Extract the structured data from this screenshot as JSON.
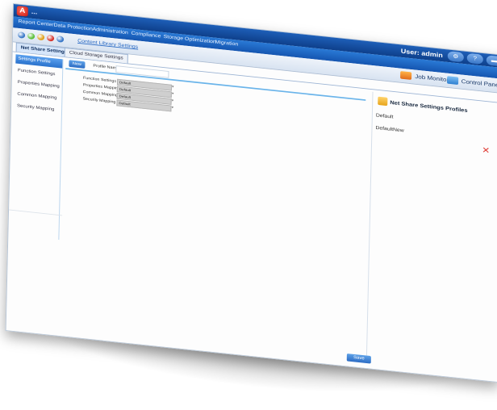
{
  "window": {
    "logo_letter": "A",
    "logo_text": "..."
  },
  "nav": {
    "items": [
      "Report Center",
      "Data Protection",
      "Administration",
      "Compliance",
      "Storage Optimization",
      "Migration"
    ]
  },
  "header": {
    "user": "User: admin",
    "icons": [
      "gear-icon",
      "help-icon",
      "minimize-icon"
    ]
  },
  "toolbar": {
    "breadcrumb": "Content Library Settings",
    "job_monitor": "Job Monitor",
    "control_panel": "Control Panel",
    "status_dots": [
      "#3a78c8",
      "#5bbf3a",
      "#e0a21e",
      "#d6332b",
      "#3a78c8"
    ]
  },
  "tabs": [
    "Net Share Settings",
    "Cloud Storage Settings"
  ],
  "sidebar": {
    "items": [
      {
        "label": "Settings Profile",
        "active": true
      },
      {
        "label": "Function Settings",
        "active": false
      },
      {
        "label": "Properties Mapping",
        "active": false
      },
      {
        "label": "Common Mapping",
        "active": false
      },
      {
        "label": "Security Mapping",
        "active": false
      }
    ]
  },
  "main": {
    "new_button": "New",
    "profile_name_label": "Profile Name",
    "profile_name_value": "",
    "form": [
      {
        "label": "Function Settings",
        "value": "Default"
      },
      {
        "label": "Properties Mapping",
        "value": "Default"
      },
      {
        "label": "Common Mapping",
        "value": "Default"
      },
      {
        "label": "Security Mapping",
        "value": "Default"
      }
    ],
    "save_button": "Save"
  },
  "right_panel": {
    "title": "Net Share Settings Profiles",
    "items": [
      "Default",
      "DefaultNew"
    ],
    "delete_symbol": "✕"
  }
}
